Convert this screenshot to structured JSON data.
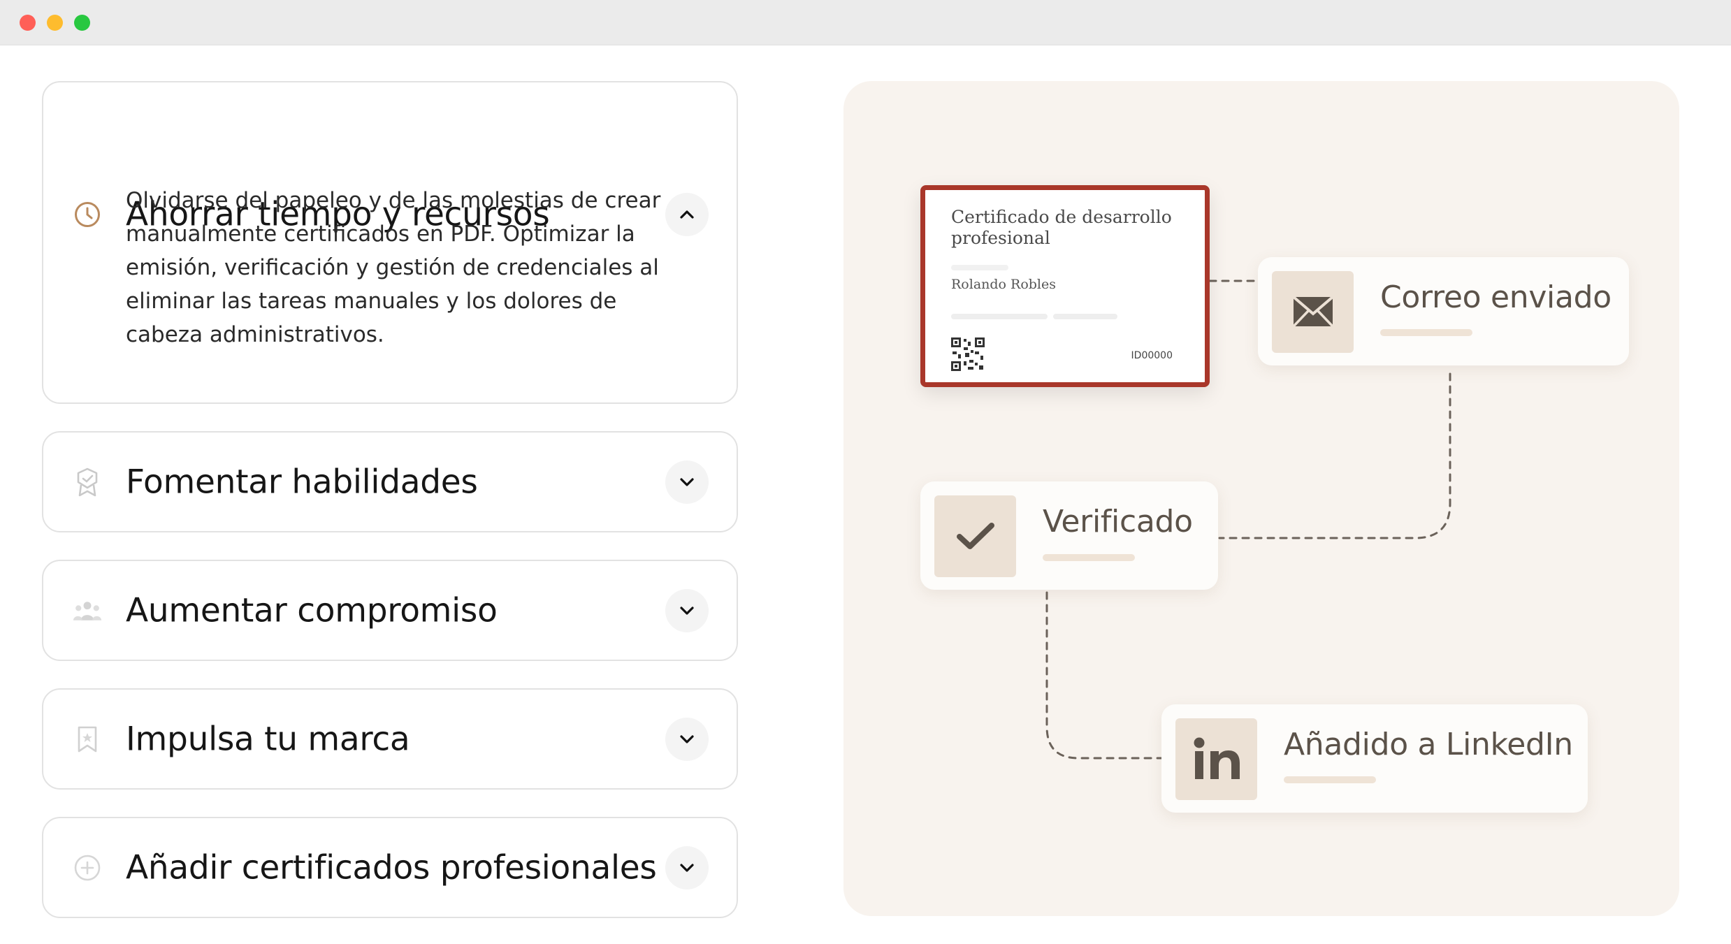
{
  "window": {
    "controls": [
      "close",
      "minimize",
      "maximize"
    ]
  },
  "accordion": [
    {
      "icon": "clock-icon",
      "title": "Ahorrar tiempo y recursos",
      "expanded": true,
      "description": "Olvidarse del papeleo y de las molestias de crear manualmente certificados en PDF. Optimizar la emisión, verificación y gestión de credenciales al eliminar las tareas manuales y los dolores de cabeza administrativos."
    },
    {
      "icon": "award-badge-icon",
      "title": "Fomentar habilidades",
      "expanded": false
    },
    {
      "icon": "people-group-icon",
      "title": "Aumentar compromiso",
      "expanded": false
    },
    {
      "icon": "bookmark-star-icon",
      "title": "Impulsa tu marca",
      "expanded": false
    },
    {
      "icon": "plus-circle-icon",
      "title": "Añadir certificados profesionales",
      "expanded": false
    }
  ],
  "illustration": {
    "certificate": {
      "title": "Certificado de desarrollo profesional",
      "recipient": "Rolando Robles",
      "id": "ID00000"
    },
    "steps": [
      {
        "icon": "envelope-icon",
        "label": "Correo enviado"
      },
      {
        "icon": "checkmark-icon",
        "label": "Verificado"
      },
      {
        "icon": "linkedin-icon",
        "label": "Añadido a LinkedIn"
      }
    ],
    "colors": {
      "panel_bg": "#f8f3ee",
      "certificate_border": "#a9372a",
      "icon_tile": "#ece1d5",
      "icon_glyph": "#5b5249"
    }
  }
}
